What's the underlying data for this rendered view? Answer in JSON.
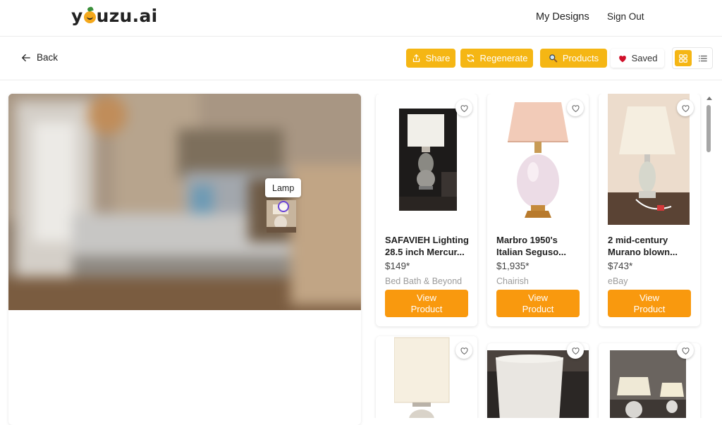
{
  "header": {
    "logo_prefix": "y",
    "logo_suffix": "uzu.ai",
    "my_designs": "My Designs",
    "sign_out": "Sign Out"
  },
  "toolbar": {
    "back": "Back",
    "share": "Share",
    "regenerate": "Regenerate",
    "products": "Products",
    "saved": "Saved"
  },
  "room": {
    "hotspot_label": "Lamp"
  },
  "products": [
    {
      "name_line1": "SAFAVIEH Lighting",
      "name_line2": "28.5 inch Mercur...",
      "price": "$149*",
      "store": "Bed Bath & Beyond",
      "button_line1": "View",
      "button_line2": "Product"
    },
    {
      "name_line1": "Marbro 1950's",
      "name_line2": "Italian Seguso...",
      "price": "$1,935*",
      "store": "Chairish",
      "button_line1": "View",
      "button_line2": "Product"
    },
    {
      "name_line1": "2 mid-century",
      "name_line2": "Murano blown...",
      "price": "$743*",
      "store": "eBay",
      "button_line1": "View",
      "button_line2": "Product"
    }
  ],
  "colors": {
    "accent": "#f5b614",
    "view_button": "#f9990e",
    "heart_saved": "#d0102a",
    "hotspot": "#6a45d6"
  },
  "icons": {
    "back": "arrow-left-icon",
    "share": "share-icon",
    "regenerate": "refresh-icon",
    "products": "magnifier-icon",
    "saved": "heart-icon",
    "grid_view": "grid-icon",
    "list_view": "list-icon",
    "favorite": "heart-outline-icon"
  }
}
